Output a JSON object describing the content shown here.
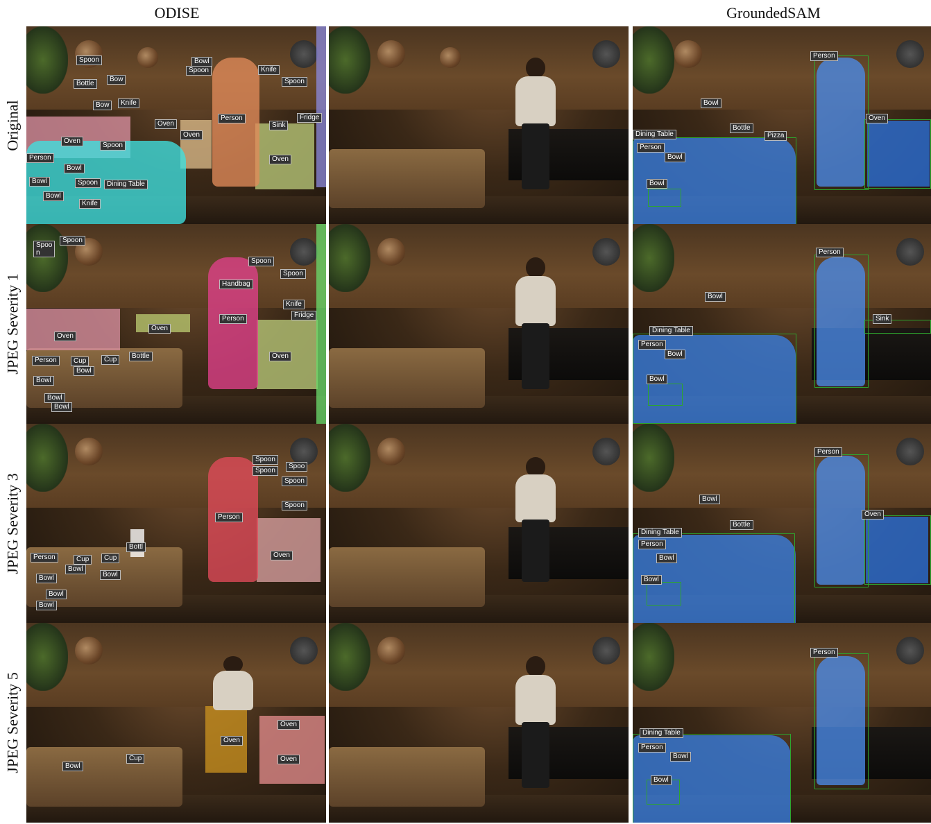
{
  "column_titles": {
    "left": "ODISE",
    "right": "GroundedSAM"
  },
  "row_labels": [
    "Original",
    "JPEG Severity 1",
    "JPEG Severity 3",
    "JPEG Severity 5"
  ],
  "colors": {
    "person": "#e08a5a",
    "table_cyan": "#3fe0e0",
    "oven_green": "#b8c878",
    "oven_tan": "#d8b888",
    "person_pink": "#e0408a",
    "person_red": "#e04a5a",
    "oven_rose": "#d8a0a0",
    "person_gold": "#c8901f",
    "sam_blue": "#3a7fe0",
    "box_green": "#2ea52e"
  },
  "odise": [
    {
      "labels": [
        "Spoon",
        "Bowl",
        "Spoon",
        "Knife",
        "Bottle",
        "Bow",
        "Spoon",
        "Bow",
        "Knife",
        "Fridge",
        "Person",
        "Oven",
        "Sink",
        "Oven",
        "Oven",
        "Spoon",
        "Oven",
        "Person",
        "Bowl",
        "Bowl",
        "Spoon",
        "Dining Table",
        "Bowl",
        "Knife"
      ]
    },
    {
      "labels": [
        "Spoo\nn",
        "Spoon",
        "Spoon",
        "Spoon",
        "Handbag",
        "Knife",
        "Fridge",
        "Oven",
        "Person",
        "Oven",
        "Oven",
        "Bottle",
        "Person",
        "Cup",
        "Cup",
        "Bowl",
        "Bowl",
        "Bowl",
        "Bowl"
      ]
    },
    {
      "labels": [
        "Spoon",
        "Spoo",
        "Spoon",
        "Spoon",
        "Spoon",
        "Person",
        "Oven",
        "Bottl",
        "Person",
        "Cup",
        "Cup",
        "Bowl",
        "Bowl",
        "Bowl",
        "Bowl",
        "Bowl"
      ]
    },
    {
      "labels": [
        "Oven",
        "Oven",
        "Oven",
        "Bowl",
        "Cup"
      ]
    }
  ],
  "grounded_sam": [
    {
      "labels": [
        "Person",
        "Bowl",
        "Oven",
        "Bottle",
        "Dining Table",
        "Pizza",
        "Person",
        "Bowl",
        "Bowl"
      ]
    },
    {
      "labels": [
        "Person",
        "Bowl",
        "Sink",
        "Dining Table",
        "Person",
        "Bowl",
        "Bowl"
      ]
    },
    {
      "labels": [
        "Person",
        "Bowl",
        "Oven",
        "Bottle",
        "Dining Table",
        "Person",
        "Bowl",
        "Bowl"
      ]
    },
    {
      "labels": [
        "Person",
        "Dining Table",
        "Person",
        "Bowl",
        "Bowl"
      ]
    }
  ]
}
